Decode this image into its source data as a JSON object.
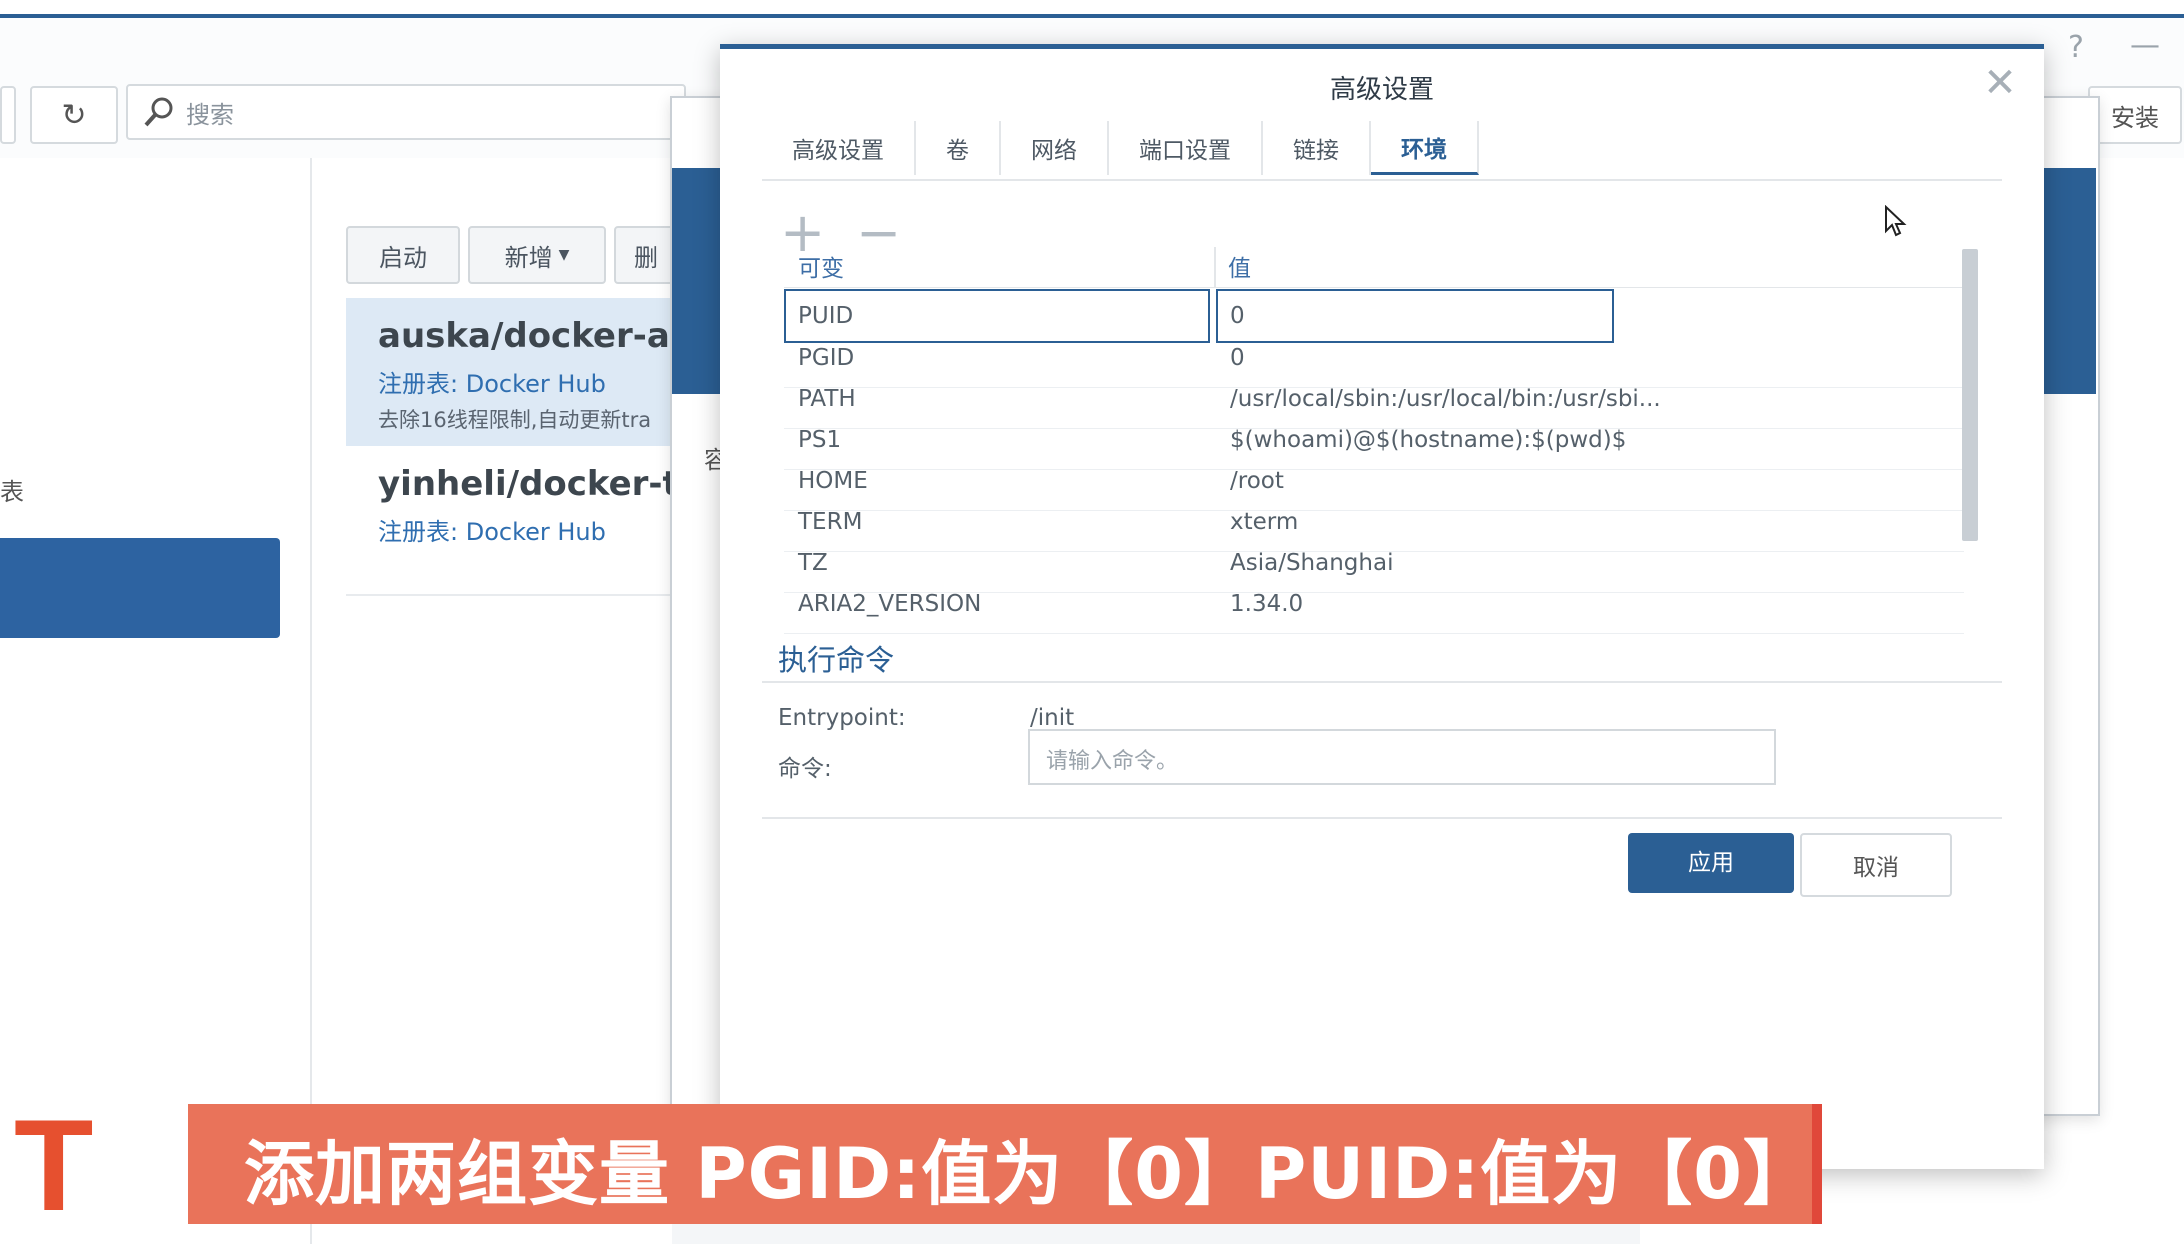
{
  "background": {
    "search_placeholder": "搜索",
    "install_label": "安装",
    "buttons": [
      "启动",
      "新增",
      "删"
    ],
    "left_partial": "表",
    "mid_partial": "容",
    "images": [
      {
        "title": "auska/docker-ar",
        "registry": "注册表: Docker Hub",
        "desc": "去除16线程限制,自动更新tra"
      },
      {
        "title": "yinheli/docker-th",
        "registry": "注册表: Docker Hub"
      }
    ]
  },
  "dialog": {
    "title": "高级设置",
    "tabs": [
      "高级设置",
      "卷",
      "网络",
      "端口设置",
      "链接",
      "环境"
    ],
    "active_tab": "环境",
    "columns": {
      "variable": "可变",
      "value": "值"
    },
    "env": [
      {
        "key": "PUID",
        "value": "0"
      },
      {
        "key": "PGID",
        "value": "0"
      },
      {
        "key": "PATH",
        "value": "/usr/local/sbin:/usr/local/bin:/usr/sbi..."
      },
      {
        "key": "PS1",
        "value": "$(whoami)@$(hostname):$(pwd)$"
      },
      {
        "key": "HOME",
        "value": "/root"
      },
      {
        "key": "TERM",
        "value": "xterm"
      },
      {
        "key": "TZ",
        "value": "Asia/Shanghai"
      },
      {
        "key": "ARIA2_VERSION",
        "value": "1.34.0"
      }
    ],
    "exec_section": "执行命令",
    "entrypoint_label": "Entrypoint:",
    "entrypoint_value": "/init",
    "command_label": "命令:",
    "command_placeholder": "请输入命令。",
    "apply_label": "应用",
    "cancel_label": "取消"
  },
  "caption": {
    "logo": "T",
    "text": "添加两组变量 PGID:值为【0】PUID:值为【0】"
  }
}
